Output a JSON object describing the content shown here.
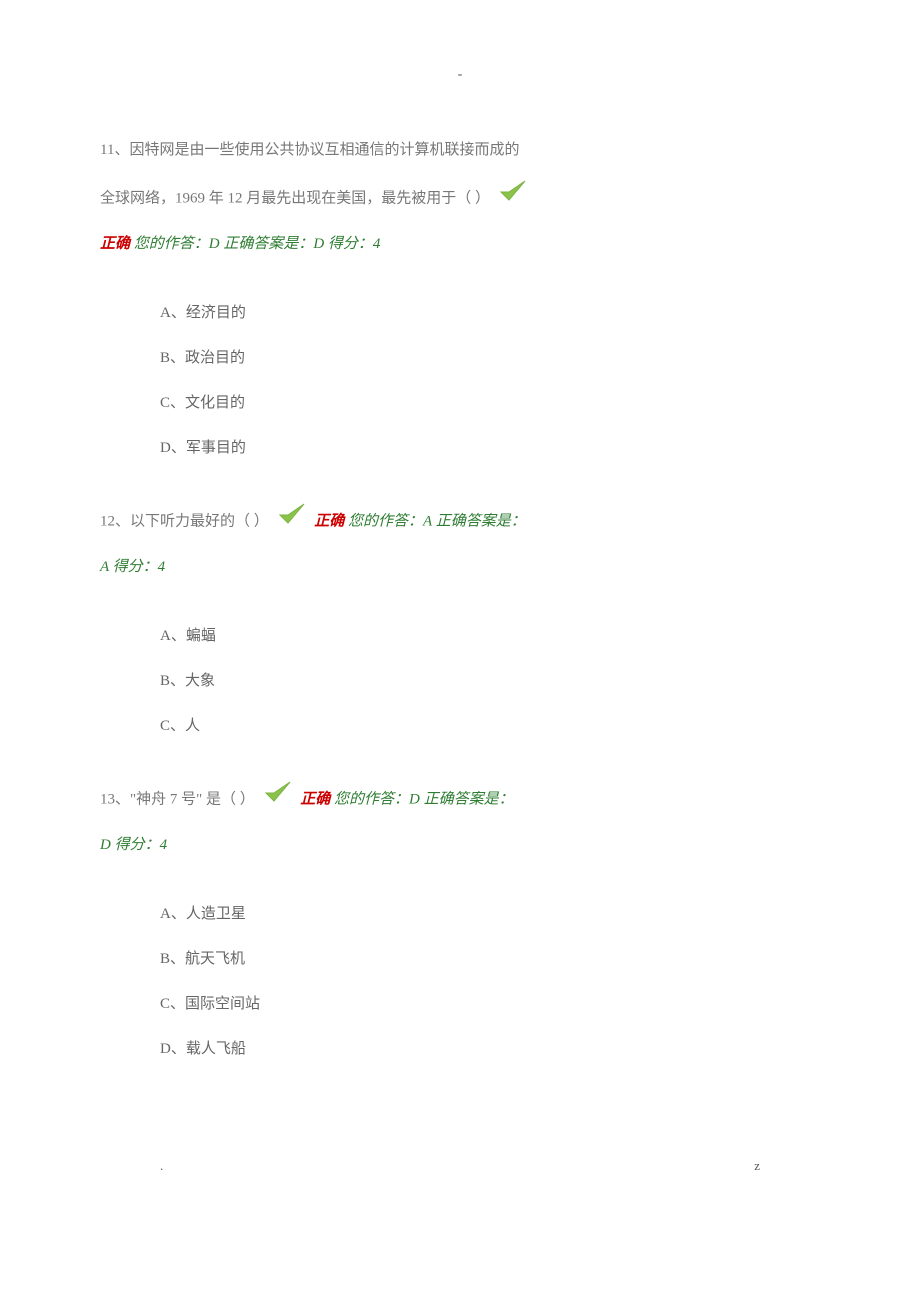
{
  "header": {
    "top_mark": "-"
  },
  "questions": [
    {
      "number": "11、",
      "text_line1": "因特网是由一些使用公共协议互相通信的计算机联接而成的",
      "text_line2": "全球网络，1969 年 12 月最先出现在美国，最先被用于（ ）",
      "feedback_label": "正确",
      "feedback_rest1": " 您的作答：D 正确答案是：D 得分：4",
      "options": [
        "A、经济目的",
        "B、政治目的",
        "C、文化目的",
        "D、军事目的"
      ]
    },
    {
      "number": "12、",
      "text_inline": "以下听力最好的（ ）",
      "feedback_label": "正确",
      "feedback_rest1": " 您的作答：A 正确答案是：",
      "feedback_rest2": "A 得分：4",
      "options": [
        "A、蝙蝠",
        "B、大象",
        "C、人"
      ]
    },
    {
      "number": "13、",
      "text_inline": "\"神舟 7 号\" 是（ ）",
      "feedback_label": "正确",
      "feedback_rest1": " 您的作答：D 正确答案是：",
      "feedback_rest2": "D 得分：4",
      "options": [
        "A、人造卫星",
        "B、航天飞机",
        "C、国际空间站",
        "D、载人飞船"
      ]
    }
  ],
  "footer": {
    "left": ".",
    "right": "z"
  }
}
